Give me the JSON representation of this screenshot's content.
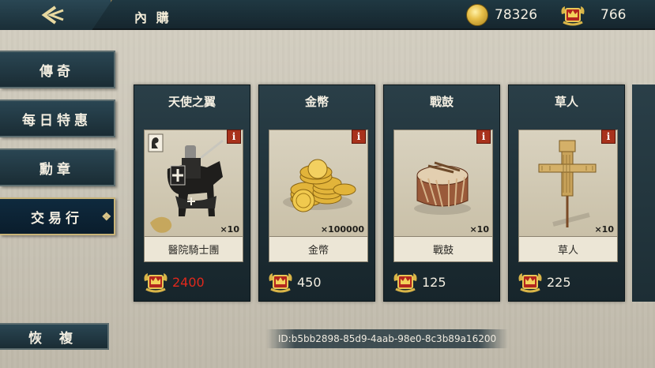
{
  "header": {
    "title": "內 購"
  },
  "currencies": [
    {
      "icon": "gold-coin-icon",
      "value": "78326"
    },
    {
      "icon": "crown-badge-icon",
      "value": "766"
    }
  ],
  "menu": {
    "items": [
      {
        "label": "傳奇",
        "active": false
      },
      {
        "label": "每日特惠",
        "active": false
      },
      {
        "label": "勳章",
        "active": false
      },
      {
        "label": "交易行",
        "active": true
      }
    ],
    "restore_label": "恢 複"
  },
  "products": [
    {
      "title": "天使之翼",
      "item_name": "醫院騎士團",
      "quantity": "×10",
      "price": "2400",
      "price_red": true,
      "art": "knight-icon"
    },
    {
      "title": "金幣",
      "item_name": "金幣",
      "quantity": "×100000",
      "price": "450",
      "price_red": false,
      "art": "gold-coins-icon"
    },
    {
      "title": "戰鼓",
      "item_name": "戰鼓",
      "quantity": "×10",
      "price": "125",
      "price_red": false,
      "art": "war-drum-icon"
    },
    {
      "title": "草人",
      "item_name": "草人",
      "quantity": "×10",
      "price": "225",
      "price_red": false,
      "art": "scarecrow-icon"
    }
  ],
  "footer": {
    "id_text": "ID:b5bb2898-85d9-4aab-98e0-8c3b89a16200"
  },
  "colors": {
    "accent_gold": "#d8c488",
    "price_red": "#e0281c",
    "panel_dark": "#1d2e35"
  }
}
